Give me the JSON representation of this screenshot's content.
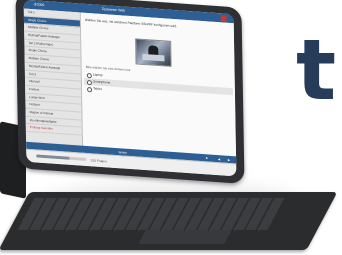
{
  "brand": {
    "letter": "t"
  },
  "app": {
    "title": "Testcenter Web",
    "user": "dr2000",
    "question": "Wählen Sie aus, mit welchem Plattform SSH/RF konfiguriert wird.",
    "instruction": "Bitte wählen Sie eine Antwort aus",
    "options": [
      {
        "label": "Laptop",
        "selected": false
      },
      {
        "label": "Smartphone",
        "selected": true
      },
      {
        "label": "Tablet",
        "selected": false
      }
    ],
    "nav_label": "Weiter",
    "status_text": "1/10 Fragen"
  },
  "sidebar": {
    "items": [
      {
        "label": "Teil 1",
        "active": false
      },
      {
        "label": "Single Choice",
        "active": true
      },
      {
        "label": "Multiple Choice",
        "active": false
      },
      {
        "label": "Richtig/Falsch-Aussage",
        "active": false
      },
      {
        "label": "Teil 2 (Fallvorlage)",
        "active": false
      },
      {
        "label": "Single Choice",
        "active": false
      },
      {
        "label": "Multiple Choice",
        "active": false
      },
      {
        "label": "Richtig/Falsch-Aussage",
        "active": false
      },
      {
        "label": "Teil 3",
        "active": false
      },
      {
        "label": "Intervall",
        "active": false
      },
      {
        "label": "Freitext",
        "active": false
      },
      {
        "label": "Lange Wort",
        "active": false
      },
      {
        "label": "Hotspot",
        "active": false
      },
      {
        "label": "Region of Interest",
        "active": false
      },
      {
        "label": "Zuordnungsaufgabe",
        "active": false
      },
      {
        "label": "Prüfung beenden",
        "active": false,
        "red": true
      }
    ]
  },
  "colors": {
    "accent": "#2d5f95",
    "brand": "#263c58"
  }
}
